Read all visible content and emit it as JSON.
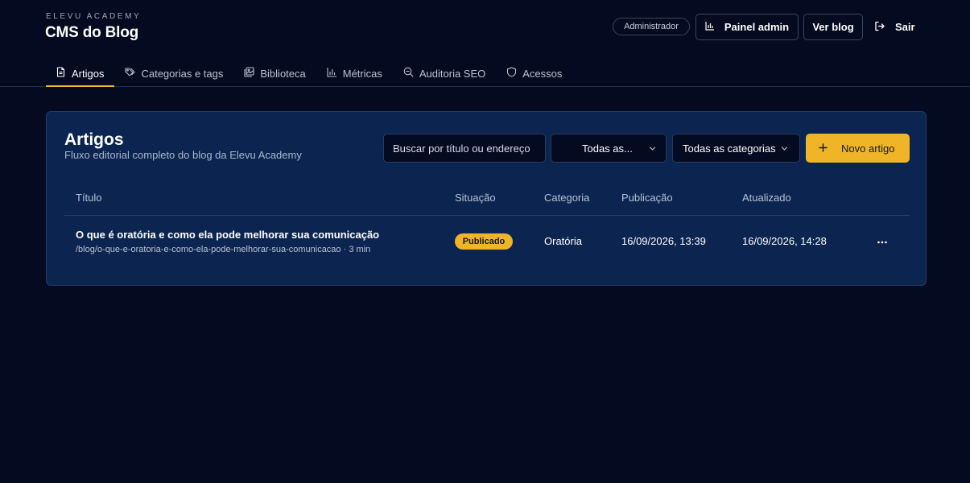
{
  "brand": {
    "eyebrow": "ELEVU ACADEMY",
    "title": "CMS do Blog"
  },
  "header": {
    "role_badge": "Administrador",
    "admin_button": "Painel admin",
    "blog_button": "Ver blog",
    "exit_button": "Sair"
  },
  "tabs": [
    {
      "label": "Artigos",
      "icon": "document-icon",
      "active": true
    },
    {
      "label": "Categorias e tags",
      "icon": "tags-icon"
    },
    {
      "label": "Biblioteca",
      "icon": "images-icon"
    },
    {
      "label": "Métricas",
      "icon": "bar-chart-icon"
    },
    {
      "label": "Auditoria SEO",
      "icon": "search-zoom-icon"
    },
    {
      "label": "Acessos",
      "icon": "shield-icon"
    }
  ],
  "colors": {
    "accent": "#f0b429",
    "background": "#040a1f",
    "panel": "#0b2550"
  },
  "panel": {
    "title": "Artigos",
    "subtitle": "Fluxo editorial completo do blog da Elevu Academy",
    "search_placeholder": "Buscar por título ou endereço",
    "status_filter": "Todas as...",
    "category_filter": "Todas as categorias",
    "new_button": "Novo artigo"
  },
  "table": {
    "columns": [
      "Título",
      "Situação",
      "Categoria",
      "Publicação",
      "Atualizado"
    ],
    "rows": [
      {
        "title": "O que é oratória e como ela pode melhorar sua comunicação",
        "slug": "/blog/o-que-e-oratoria-e-como-ela-pode-melhorar-sua-comunicacao · 3 min",
        "status": "Publicado",
        "category": "Oratória",
        "published": "16/09/2026, 13:39",
        "updated": "16/09/2026, 14:28"
      }
    ]
  }
}
